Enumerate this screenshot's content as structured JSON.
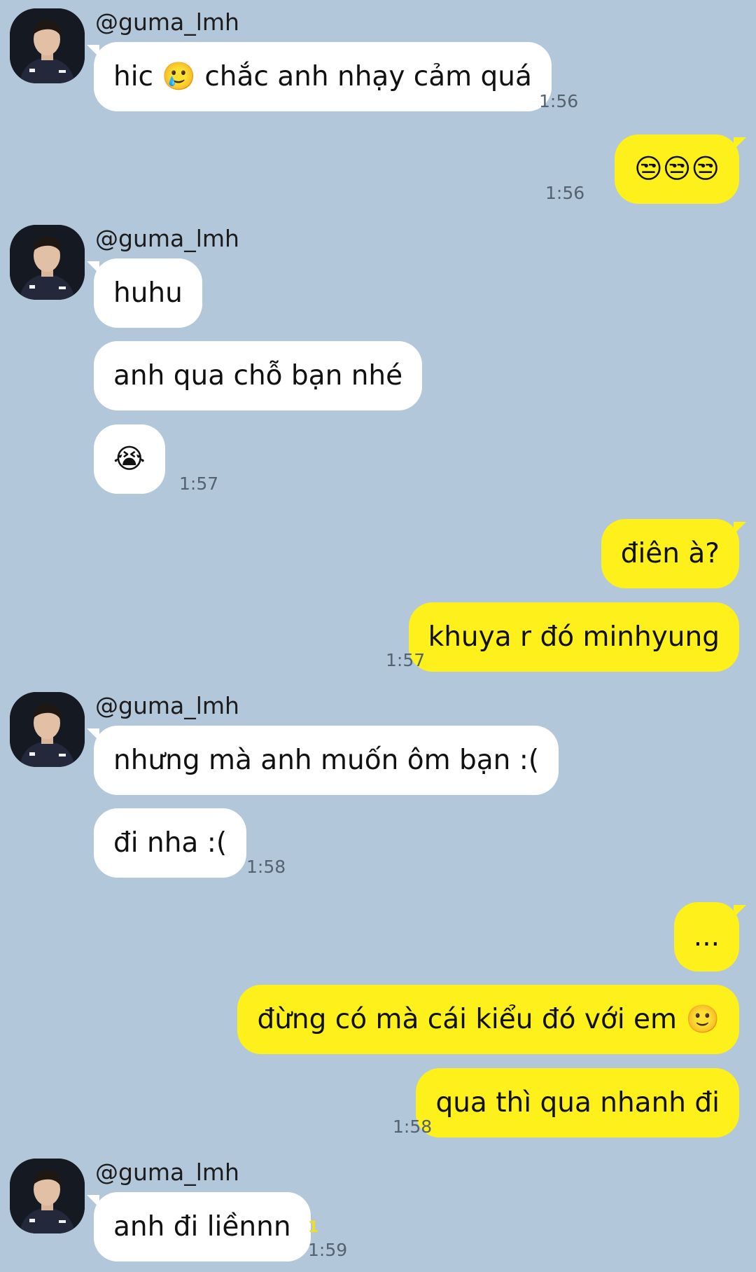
{
  "conversation": {
    "contact": {
      "name": "@guma_lmh"
    },
    "groups": [
      {
        "time": "1:56",
        "messages": [
          "hic 🥲 chắc anh nhạy cảm quá"
        ]
      },
      {
        "time": "1:56",
        "messages": [
          "😒😒😒"
        ]
      },
      {
        "time": "1:57",
        "messages": [
          "huhu",
          "anh qua chỗ bạn nhé",
          "😭"
        ]
      },
      {
        "time": "1:57",
        "messages": [
          "điên à?",
          "khuya r đó minhyung"
        ]
      },
      {
        "time": "1:58",
        "messages": [
          "nhưng mà anh muốn ôm bạn :(",
          "đi nha :("
        ]
      },
      {
        "time": "1:58",
        "messages": [
          "...",
          "đừng có mà cái kiểu đó với em 🙂",
          "qua thì qua nhanh đi"
        ]
      },
      {
        "time": "1:59",
        "unread": "1",
        "messages": [
          "anh đi liềnnn"
        ]
      }
    ]
  },
  "theme": {
    "background": "#b3c7db",
    "incoming_bubble": "#ffffff",
    "outgoing_bubble": "#fef01b"
  }
}
